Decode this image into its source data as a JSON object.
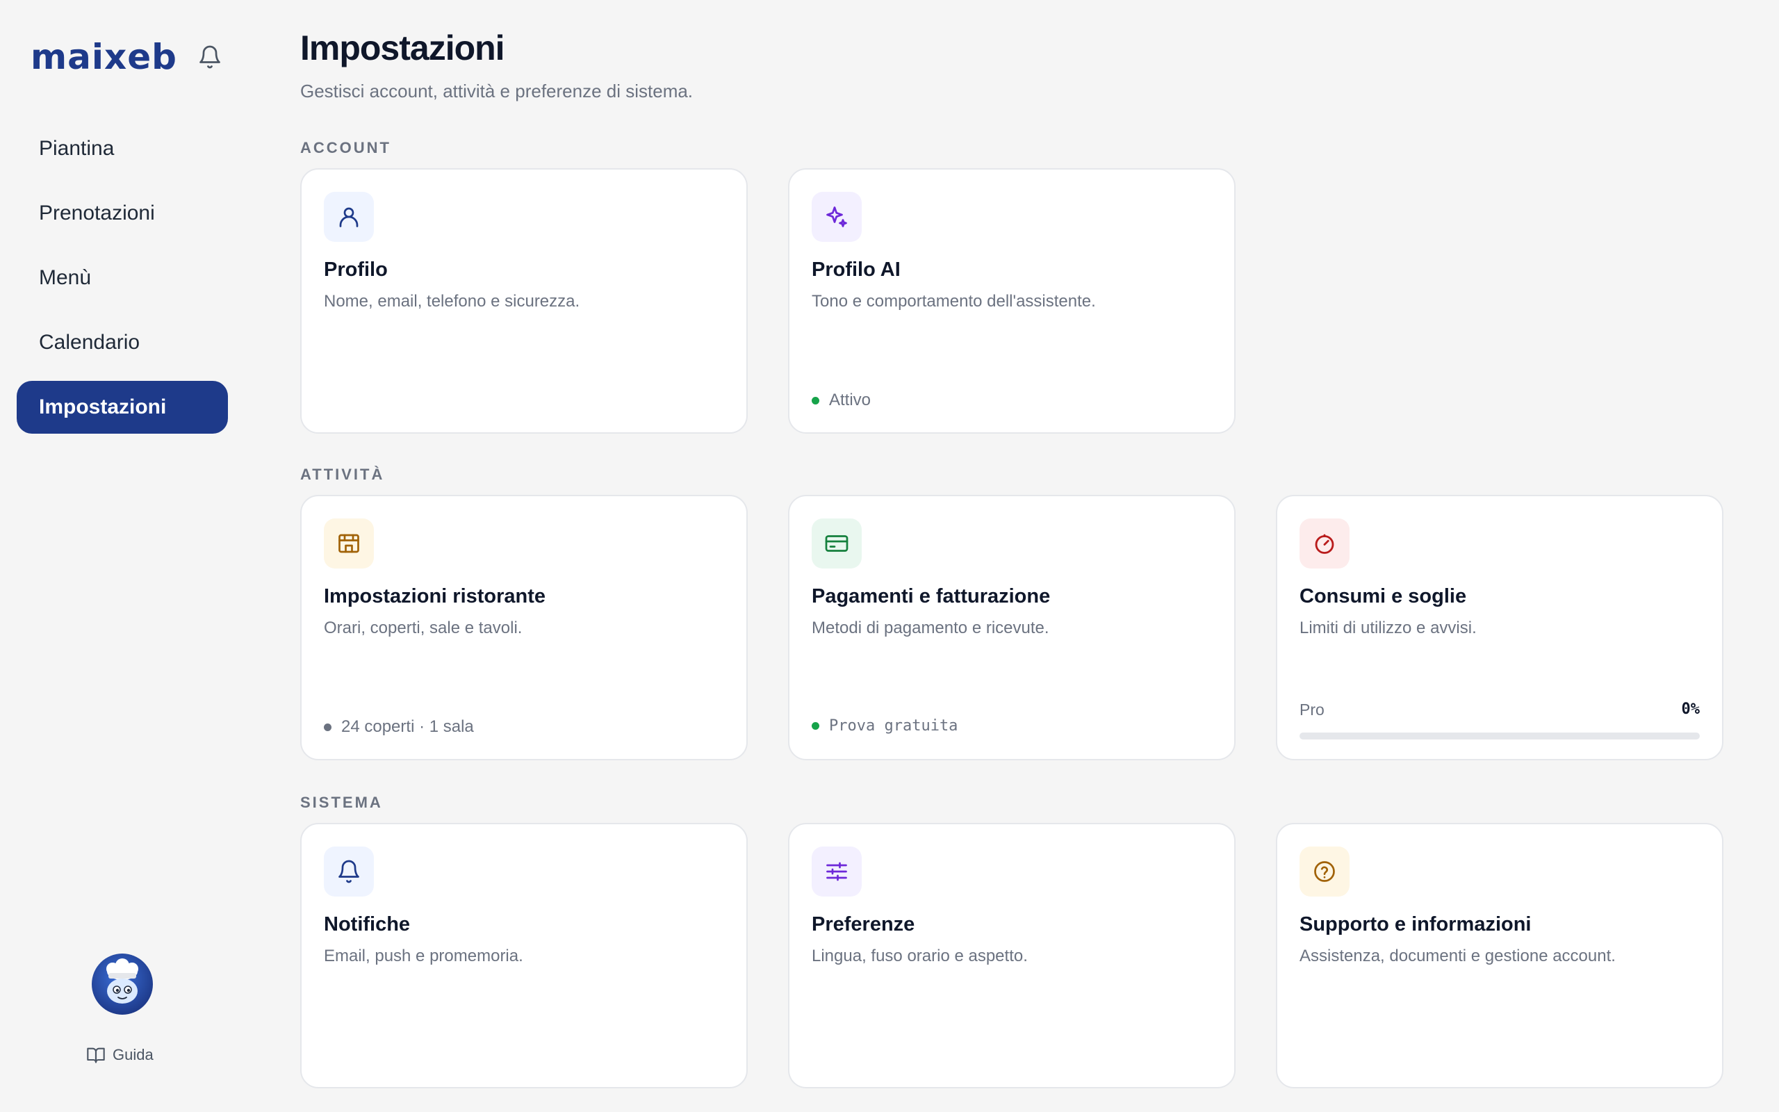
{
  "app": {
    "logo": "maixeb"
  },
  "sidebar": {
    "items": [
      {
        "label": "Piantina",
        "active": false
      },
      {
        "label": "Prenotazioni",
        "active": false
      },
      {
        "label": "Menù",
        "active": false
      },
      {
        "label": "Calendario",
        "active": false
      },
      {
        "label": "Impostazioni",
        "active": true
      }
    ],
    "guide_label": "Guida"
  },
  "page": {
    "title": "Impostazioni",
    "subtitle": "Gestisci account, attività e preferenze di sistema."
  },
  "sections": {
    "account": {
      "label": "ACCOUNT",
      "cards": [
        {
          "icon": "user-icon",
          "title": "Profilo",
          "description": "Nome, email, telefono e sicurezza."
        },
        {
          "icon": "sparkles-icon",
          "title": "Profilo AI",
          "description": "Tono e comportamento dell'assistente.",
          "status": "Attivo"
        }
      ]
    },
    "attivita": {
      "label": "ATTIVITÀ",
      "cards": [
        {
          "icon": "store-icon",
          "title": "Impostazioni ristorante",
          "description": "Orari, coperti, sale e tavoli.",
          "status": "24 coperti · 1 sala"
        },
        {
          "icon": "credit-card-icon",
          "title": "Pagamenti e fatturazione",
          "description": "Metodi di pagamento e ricevute.",
          "status": "Prova gratuita"
        },
        {
          "icon": "gauge-icon",
          "title": "Consumi e soglie",
          "description": "Limiti di utilizzo e avvisi.",
          "plan": "Pro",
          "usage_percent_label": "0%",
          "usage_percent": 0
        }
      ]
    },
    "sistema": {
      "label": "SISTEMA",
      "cards": [
        {
          "icon": "bell-icon",
          "title": "Notifiche",
          "description": "Email, push e promemoria."
        },
        {
          "icon": "sliders-icon",
          "title": "Preferenze",
          "description": "Lingua, fuso orario e aspetto."
        },
        {
          "icon": "help-circle-icon",
          "title": "Supporto e informazioni",
          "description": "Assistenza, documenti e gestione account."
        }
      ]
    }
  },
  "colors": {
    "brand": "#1e3a8a",
    "status_green": "#16a34a",
    "status_gray": "#6b7280"
  }
}
